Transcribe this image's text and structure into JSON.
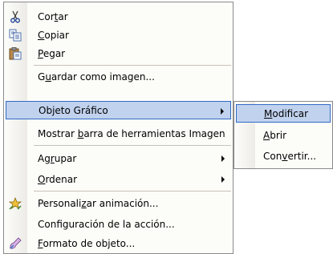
{
  "menu": {
    "items": [
      {
        "pre": "Cor",
        "ul": "t",
        "post": "ar",
        "icon": "scissors-icon"
      },
      {
        "pre": "",
        "ul": "C",
        "post": "opiar",
        "icon": "copy-icon"
      },
      {
        "pre": "",
        "ul": "P",
        "post": "egar",
        "icon": "paste-icon"
      },
      {
        "pre": "G",
        "ul": "u",
        "post": "ardar como imagen...",
        "icon": ""
      },
      {
        "pre": "Ob",
        "ul": "j",
        "post": "eto Gráfico",
        "icon": ""
      },
      {
        "pre": "Mostrar ",
        "ul": "b",
        "post": "arra de herramientas Imagen",
        "icon": ""
      },
      {
        "pre": "Ag",
        "ul": "r",
        "post": "upar",
        "icon": ""
      },
      {
        "pre": "",
        "ul": "O",
        "post": "rdenar",
        "icon": ""
      },
      {
        "pre": "Personali",
        "ul": "z",
        "post": "ar animación...",
        "icon": "custom-animation-icon"
      },
      {
        "pre": "Conf",
        "ul": "i",
        "post": "guración de la acción...",
        "icon": ""
      },
      {
        "pre": "",
        "ul": "F",
        "post": "ormato de objeto...",
        "icon": "format-object-icon"
      }
    ]
  },
  "submenu": {
    "items": [
      {
        "pre": "",
        "ul": "M",
        "post": "odificar"
      },
      {
        "pre": "",
        "ul": "A",
        "post": "brir"
      },
      {
        "pre": "Con",
        "ul": "v",
        "post": "ertir..."
      }
    ]
  },
  "colors": {
    "highlight_bg": "#c1d2ee",
    "highlight_border": "#316ac5",
    "separator": "#c5c2b8"
  }
}
